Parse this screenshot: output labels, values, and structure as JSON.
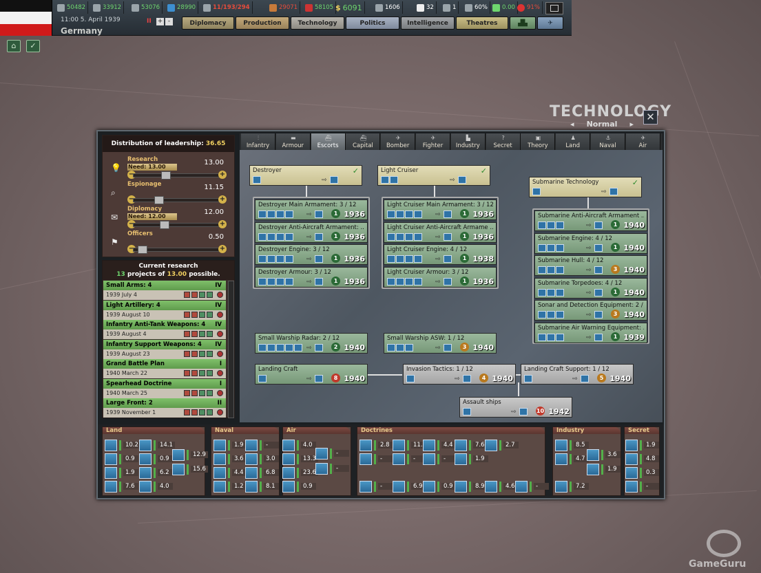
{
  "country": {
    "name": "Germany",
    "datetime": "11:00 5. April 1939"
  },
  "resources": {
    "energy": "50482",
    "metal": "33912",
    "rare": "53076",
    "oil": "28990",
    "officers_ratio": "11/193/294",
    "supplies": "29071",
    "fuel": "58105",
    "money": "6091",
    "manpower": "1606",
    "diplomacy": "32",
    "spies": "1",
    "national_unity": "60%",
    "dissent": "0.00",
    "neutrality": "91%"
  },
  "speed_controls": {
    "pause": "II",
    "plus": "+",
    "minus": "-"
  },
  "main_tabs": [
    "Diplomacy",
    "Production",
    "Technology",
    "Politics",
    "Intelligence",
    "Theatres"
  ],
  "window": {
    "title": "TECHNOLOGY",
    "mode": "Normal",
    "close": "✕",
    "prev": "◂",
    "next": "▸"
  },
  "leadership": {
    "title_prefix": "Distribution of leadership:",
    "total": "36.65",
    "rows": [
      {
        "label": "Research",
        "need": "Need: 13.00",
        "value": "13.00"
      },
      {
        "label": "Espionage",
        "need": "",
        "value": "11.15"
      },
      {
        "label": "Diplomacy",
        "need": "Need: 12.00",
        "value": "12.00"
      },
      {
        "label": "Officers",
        "need": "",
        "value": "0.50"
      }
    ]
  },
  "current_research": {
    "title": "Current research",
    "count": "13",
    "text_mid": "projects of",
    "max": "13.00",
    "text_end": "possible.",
    "items": [
      {
        "name": "Small Arms: 4",
        "level": "IV",
        "date": "1939 July 4"
      },
      {
        "name": "Light Artillery: 4",
        "level": "IV",
        "date": "1939 August 10"
      },
      {
        "name": "Infantry Anti-Tank Weapons: 4",
        "level": "IV",
        "date": "1939 August 4"
      },
      {
        "name": "Infantry Support Weapons: 4",
        "level": "IV",
        "date": "1939 August 23"
      },
      {
        "name": "Grand Battle Plan",
        "level": "I",
        "date": "1940 March 22"
      },
      {
        "name": "Spearhead Doctrine",
        "level": "I",
        "date": "1940 March 25"
      },
      {
        "name": "Large Front: 2",
        "level": "II",
        "date": "1939 November 1"
      }
    ]
  },
  "categories": [
    "Infantry",
    "Armour",
    "Escorts",
    "Capital",
    "Bomber",
    "Fighter",
    "Industry",
    "Secret",
    "Theory",
    "Land",
    "Naval",
    "Air"
  ],
  "selected_category": "Escorts",
  "tree": {
    "roots": [
      {
        "name": "Destroyer"
      },
      {
        "name": "Light Cruiser"
      },
      {
        "name": "Submarine Technology"
      }
    ],
    "destroyer": [
      {
        "name": "Destroyer Main Armament: 3 / 12",
        "lv": "1",
        "year": "1936"
      },
      {
        "name": "Destroyer Anti-Aircraft Armament: ...",
        "lv": "1",
        "year": "1936"
      },
      {
        "name": "Destroyer Engine: 3 / 12",
        "lv": "1",
        "year": "1936"
      },
      {
        "name": "Destroyer Armour: 3 / 12",
        "lv": "1",
        "year": "1936"
      }
    ],
    "cruiser": [
      {
        "name": "Light Cruiser Main Armament: 3 / 12",
        "lv": "1",
        "year": "1936"
      },
      {
        "name": "Light Cruiser Anti-Aircraft Armame ...",
        "lv": "1",
        "year": "1936"
      },
      {
        "name": "Light Cruiser Engine: 4 / 12",
        "lv": "1",
        "year": "1938"
      },
      {
        "name": "Light Cruiser Armour: 3 / 12",
        "lv": "1",
        "year": "1936"
      }
    ],
    "submarine": [
      {
        "name": "Submarine Anti-Aircraft Armament ...",
        "lv": "1",
        "year": "1940"
      },
      {
        "name": "Submarine Engine: 4 / 12",
        "lv": "1",
        "year": "1940"
      },
      {
        "name": "Submarine Hull: 4 / 12",
        "lv": "3",
        "year": "1940"
      },
      {
        "name": "Submarine Torpedoes: 4 / 12",
        "lv": "1",
        "year": "1940"
      },
      {
        "name": "Sonar and Detection Equipment: 2 / 12",
        "lv": "3",
        "year": "1940"
      },
      {
        "name": "Submarine Air Warning Equipment: ...",
        "lv": "1",
        "year": "1939"
      }
    ],
    "others": [
      {
        "name": "Small Warship Radar: 2 / 12",
        "lv": "2",
        "year": "1940"
      },
      {
        "name": "Small Warship ASW: 1 / 12",
        "lv": "3",
        "year": "1940"
      },
      {
        "name": "Landing Craft",
        "lv": "8",
        "year": "1940"
      },
      {
        "name": "Invasion Tactics: 1 / 12",
        "lv": "4",
        "year": "1940"
      },
      {
        "name": "Landing Craft Support: 1 / 12",
        "lv": "5",
        "year": "1940"
      },
      {
        "name": "Assault ships",
        "lv": "10",
        "year": "1942"
      }
    ]
  },
  "bottom": {
    "land": {
      "title": "Land",
      "values": [
        "10.2",
        "14.1",
        "0.9",
        "0.9",
        "1.9",
        "6.2",
        "7.6",
        "4.0",
        "12.9",
        "15.6"
      ]
    },
    "naval": {
      "title": "Naval",
      "values": [
        "1.9",
        "-",
        "3.6",
        "3.0",
        "4.4",
        "6.8",
        "1.2",
        "8.1"
      ]
    },
    "air": {
      "title": "Air",
      "values": [
        "4.0",
        "13.3",
        "23.6",
        "0.9",
        "-",
        "-"
      ]
    },
    "doctrines": {
      "title": "Doctrines",
      "values": [
        "2.8",
        "11.1",
        "4.4",
        "7.6",
        "2.7",
        "-",
        "-",
        "-",
        "1.9",
        "-",
        "6.9",
        "0.9",
        "8.9",
        "4.6",
        "-"
      ]
    },
    "industry": {
      "title": "Industry",
      "values": [
        "8.5",
        "4.7",
        "7.2",
        "3.6",
        "1.9"
      ]
    },
    "secret": {
      "title": "Secret",
      "values": [
        "1.9",
        "4.8",
        "0.3",
        "-"
      ]
    }
  },
  "watermark": "GameGuru",
  "colors": {
    "research_green": "#6aab55",
    "node_tan": "#d8d0a8",
    "node_green": "#8fae90",
    "accent_yellow": "#f0d060"
  }
}
